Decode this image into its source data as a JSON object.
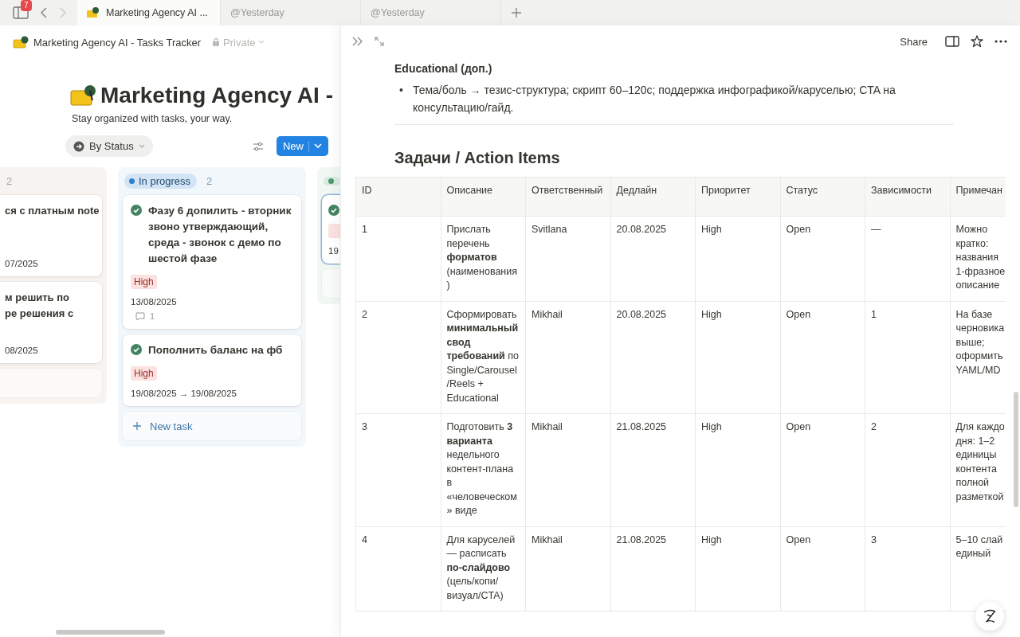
{
  "tabbar": {
    "badge": "7",
    "tabs": [
      {
        "title": "Marketing Agency AI ...",
        "selected": true
      },
      {
        "title": "@Yesterday",
        "selected": false
      },
      {
        "title": "@Yesterday",
        "selected": false
      }
    ]
  },
  "page": {
    "breadcrumb": "Marketing Agency AI - Tasks Tracker",
    "privacy": "Private",
    "title": "Marketing Agency AI -",
    "description": "Stay organized with tasks, your way.",
    "view": "By Status",
    "new_button": "New"
  },
  "board": {
    "columns": [
      {
        "count": "2",
        "cards": [
          {
            "title": "ся с платным note",
            "date": "07/2025"
          },
          {
            "title": "м решить по\nре решения с",
            "date": "08/2025"
          }
        ]
      },
      {
        "label": "In progress",
        "count": "2",
        "color": "#2f80d1",
        "cards": [
          {
            "title": "Фазу 6 допилить - вторник звоно утверждающий, среда - звонок с демо по шестой фазе",
            "done": true,
            "priority": "High",
            "date": "13/08/2025",
            "comments": "1"
          },
          {
            "title": "Пополнить баланс на фб",
            "done": true,
            "priority": "High",
            "date": "19/08/2025 → 19/08/2025"
          }
        ],
        "add_label": "New task"
      },
      {
        "color": "#4a9a6b",
        "cards": [
          {
            "done": true,
            "tag": true,
            "date": "19",
            "focused": true
          }
        ]
      }
    ]
  },
  "peek": {
    "share": "Share",
    "section_heading": "Educational (доп.)",
    "bullets": [
      {
        "marker": "•",
        "text": "Тема/боль → тезис-структура; скрипт 60–120с; поддержка инфографикой/каруселью; CTA на консультацию/гайд."
      }
    ],
    "heading": "Задачи / Action Items",
    "table": {
      "columns": [
        "ID",
        "Описание",
        "Ответственный",
        "Дедлайн",
        "Приоритет",
        "Статус",
        "Зависимости",
        "Примечан"
      ],
      "rows": [
        [
          "1",
          "Прислать перечень **форматов** (наименования)",
          "Svitlana",
          "20.08.2025",
          "High",
          "Open",
          "—",
          "Можно\nкратко:\nназвания\n1-фразное\nописание"
        ],
        [
          "2",
          "Сформировать **минимальный свод требований** по Single/Carousel/Reels + Educational",
          "Mikhail",
          "20.08.2025",
          "High",
          "Open",
          "1",
          "На базе\nчерновика\nвыше;\nоформить\nYAML/MD"
        ],
        [
          "3",
          "Подготовить **3 варианта** недельного контент-плана в «человеческом» виде",
          "Mikhail",
          "21.08.2025",
          "High",
          "Open",
          "2",
          "Для каждо\nдня: 1–2\nединицы\nконтента\nполной\nразметкой"
        ],
        [
          "4",
          "Для каруселей — расписать **по-слайдово** (цель/копи/визуал/CTA)",
          "Mikhail",
          "21.08.2025",
          "High",
          "Open",
          "3",
          "5–10 слай\nединый"
        ]
      ]
    }
  }
}
